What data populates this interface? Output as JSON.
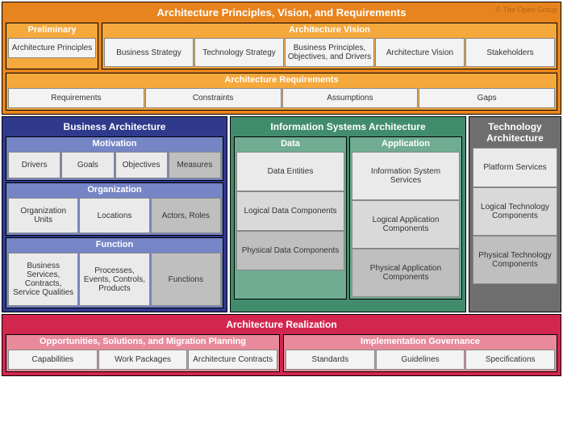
{
  "watermark": "© The Open Group",
  "top": {
    "title": "Architecture Principles, Vision, and Requirements",
    "preliminary": {
      "title": "Preliminary",
      "cells": [
        "Architecture Principles"
      ]
    },
    "vision": {
      "title": "Architecture Vision",
      "cells": [
        "Business Strategy",
        "Technology Strategy",
        "Business Principles, Objectives, and Drivers",
        "Architecture Vision",
        "Stakeholders"
      ]
    },
    "reqs": {
      "title": "Architecture Requirements",
      "cells": [
        "Requirements",
        "Constraints",
        "Assumptions",
        "Gaps"
      ]
    }
  },
  "biz": {
    "title": "Business Architecture",
    "groups": [
      {
        "title": "Motivation",
        "cells": [
          "Drivers",
          "Goals",
          "Objectives",
          "Measures"
        ]
      },
      {
        "title": "Organization",
        "cells": [
          "Organization Units",
          "Locations",
          "Actors, Roles"
        ]
      },
      {
        "title": "Function",
        "cells": [
          "Business Services, Contracts, Service Qualities",
          "Processes, Events, Controls, Products",
          "Functions"
        ]
      }
    ]
  },
  "info": {
    "title": "Information Systems Architecture",
    "data": {
      "title": "Data",
      "cells": [
        "Data Entities",
        "Logical Data Components",
        "Physical Data Components"
      ]
    },
    "app": {
      "title": "Application",
      "cells": [
        "Information System Services",
        "Logical Application Components",
        "Physical Application Components"
      ]
    }
  },
  "tech": {
    "title": "Technology Architecture",
    "cells": [
      "Platform Services",
      "Logical Technology Components",
      "Physical Technology Components"
    ]
  },
  "bottom": {
    "title": "Architecture Realization",
    "opp": {
      "title": "Opportunities, Solutions, and Migration Planning",
      "cells": [
        "Capabilities",
        "Work Packages",
        "Architecture Contracts"
      ]
    },
    "gov": {
      "title": "Implementation Governance",
      "cells": [
        "Standards",
        "Guidelines",
        "Specifications"
      ]
    }
  }
}
